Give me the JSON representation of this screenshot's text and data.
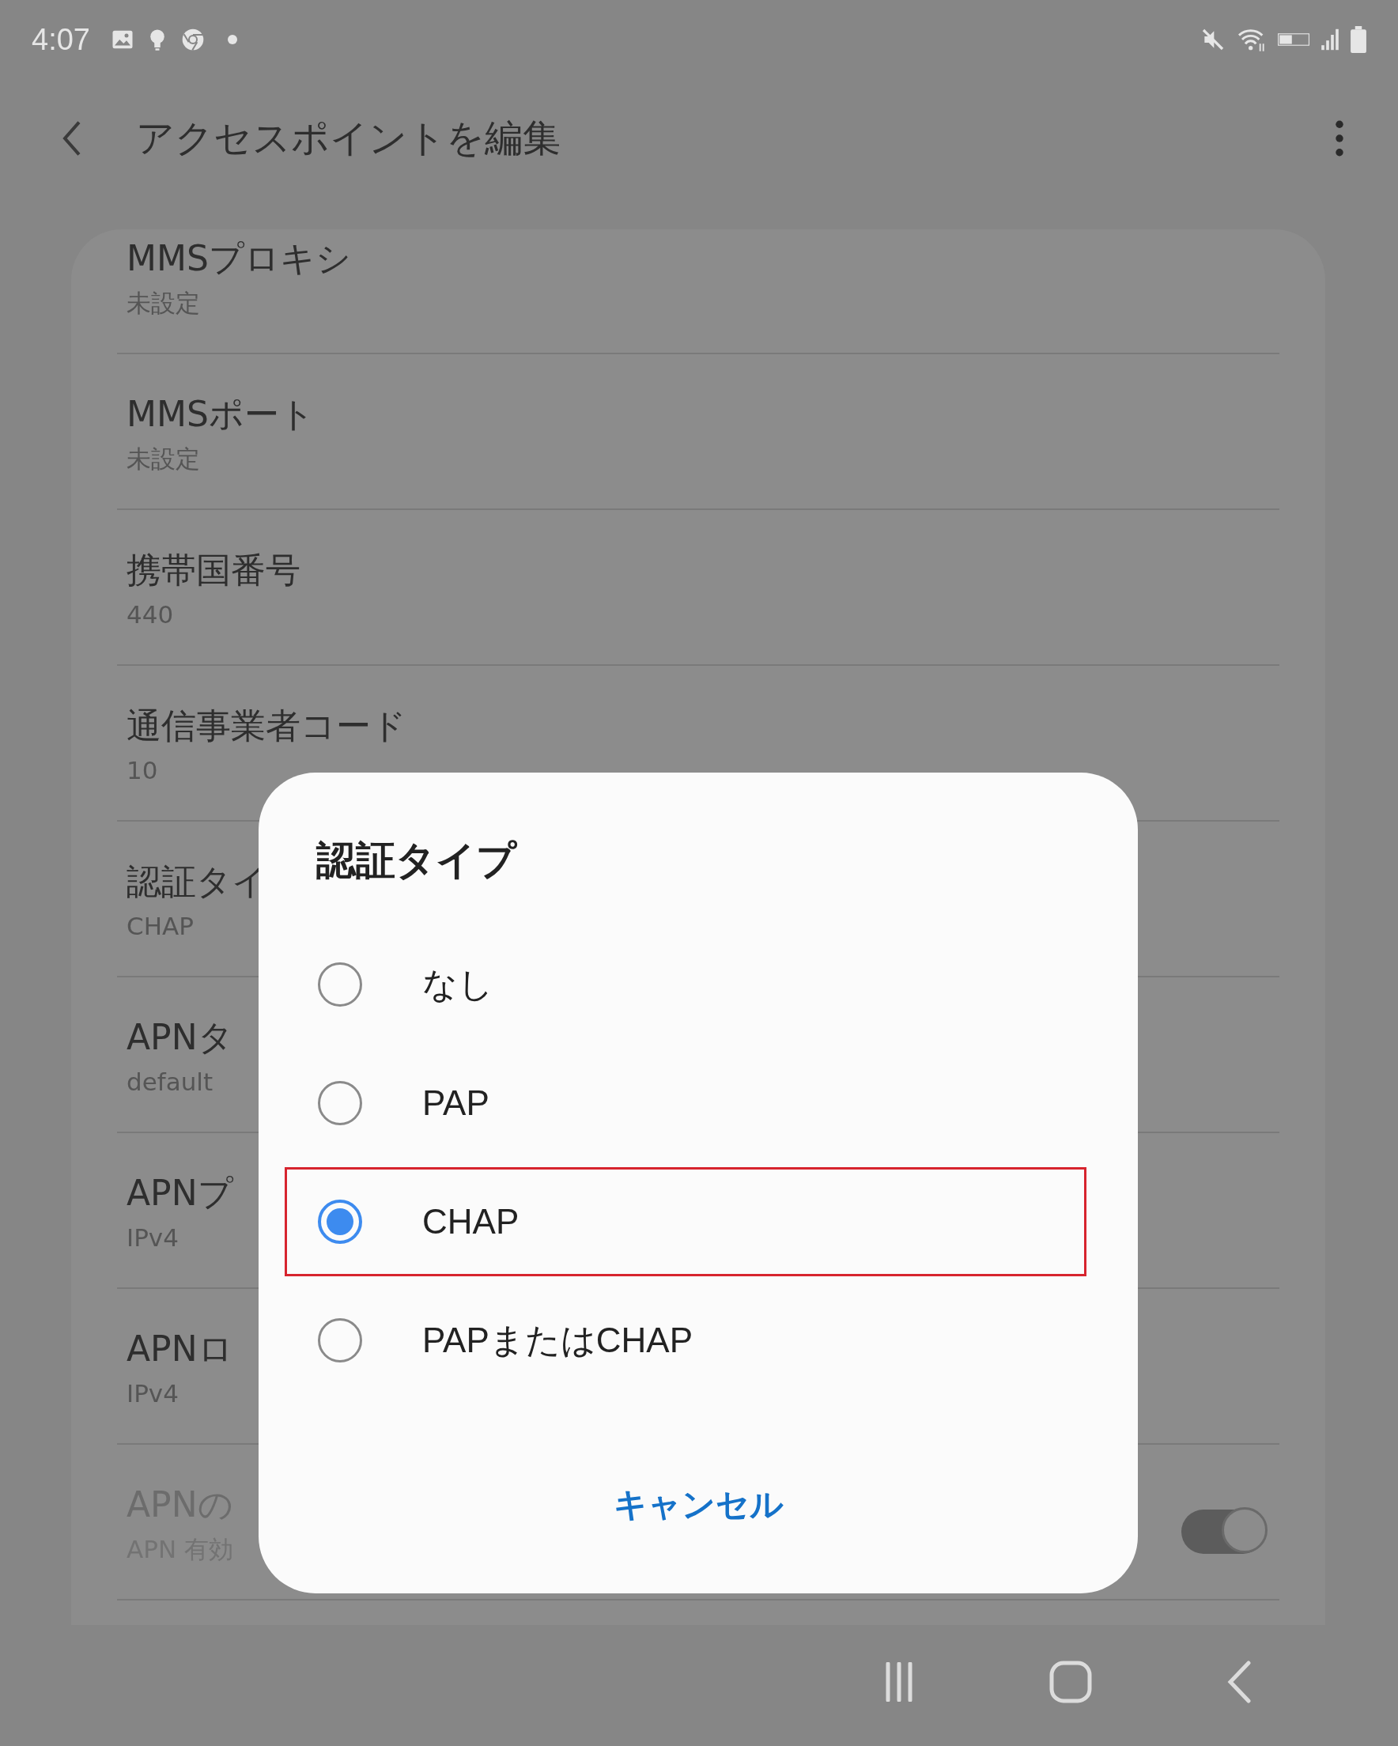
{
  "status_bar": {
    "time": "4:07"
  },
  "app_bar": {
    "title": "アクセスポイントを編集"
  },
  "settings": [
    {
      "kind": "text",
      "title": "MMSプロキシ",
      "value": "未設定",
      "disabled": false
    },
    {
      "kind": "text",
      "title": "MMSポート",
      "value": "未設定",
      "disabled": false
    },
    {
      "kind": "text",
      "title": "携帯国番号",
      "value": "440",
      "disabled": false
    },
    {
      "kind": "text",
      "title": "通信事業者コード",
      "value": "10",
      "disabled": false
    },
    {
      "kind": "text",
      "title": "認証タイ",
      "value": "CHAP",
      "disabled": false
    },
    {
      "kind": "text",
      "title": "APNタ",
      "value": "default",
      "disabled": false
    },
    {
      "kind": "text",
      "title": "APNプ",
      "value": "IPv4",
      "disabled": false
    },
    {
      "kind": "text",
      "title": "APNロ",
      "value": "IPv4",
      "disabled": false
    },
    {
      "kind": "toggle",
      "title": "APNの",
      "value": "APN 有効",
      "disabled": true,
      "on": true
    }
  ],
  "dialog": {
    "title": "認証タイプ",
    "options": [
      {
        "label": "なし",
        "selected": false,
        "highlighted": false
      },
      {
        "label": "PAP",
        "selected": false,
        "highlighted": false
      },
      {
        "label": "CHAP",
        "selected": true,
        "highlighted": true
      },
      {
        "label": "PAPまたはCHAP",
        "selected": false,
        "highlighted": false
      }
    ],
    "cancel": "キャンセル"
  }
}
